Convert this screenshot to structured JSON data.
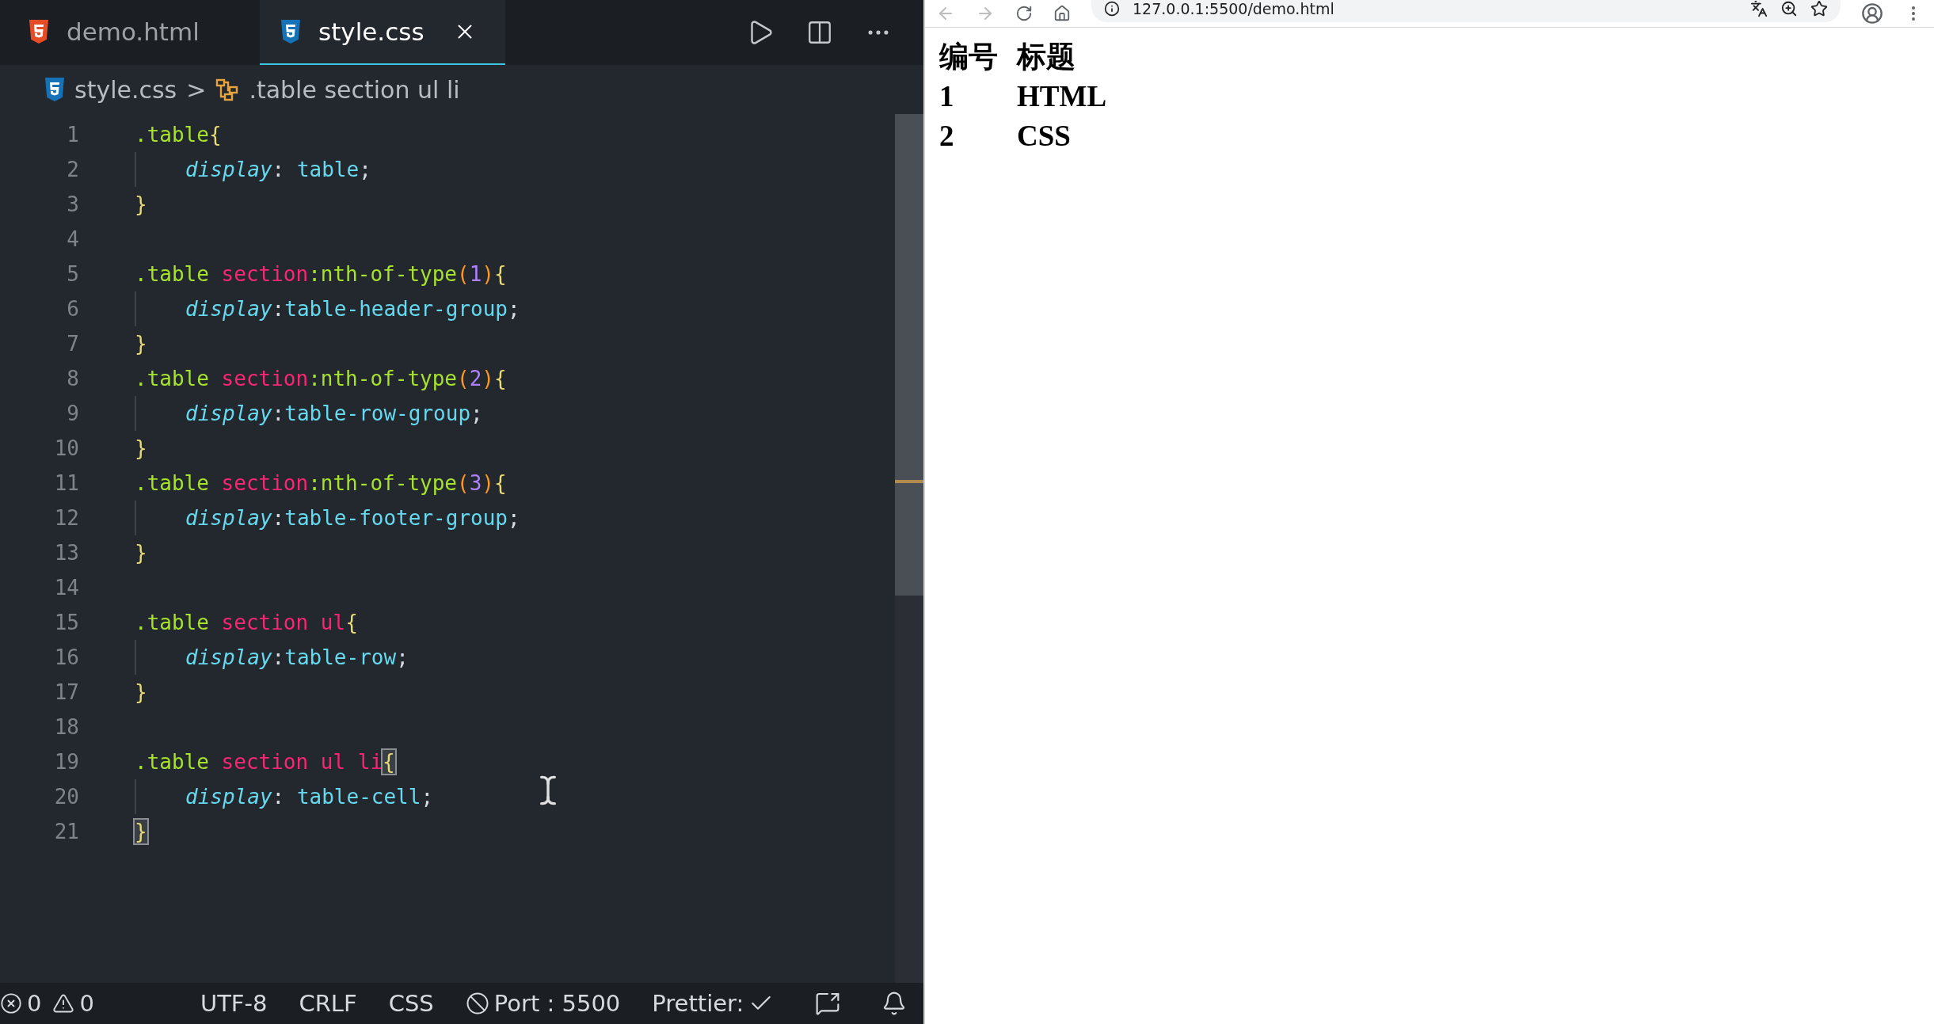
{
  "editor": {
    "tabs": [
      {
        "label": "demo.html",
        "kind": "html",
        "selected": false
      },
      {
        "label": "style.css",
        "kind": "css",
        "selected": true
      }
    ],
    "breadcrumb": {
      "file": "style.css",
      "separator": ">",
      "symbol": ".table section ul li"
    },
    "lines": [
      {
        "number": "1",
        "indented": false,
        "tokens": [
          {
            "text": ".table",
            "kind": "class"
          },
          {
            "text": "{",
            "kind": "brace"
          }
        ]
      },
      {
        "number": "2",
        "indented": true,
        "tokens": [
          {
            "text": "display",
            "kind": "prop"
          },
          {
            "text": ": ",
            "kind": "punct"
          },
          {
            "text": "table",
            "kind": "value"
          },
          {
            "text": ";",
            "kind": "punct"
          }
        ]
      },
      {
        "number": "3",
        "indented": false,
        "tokens": [
          {
            "text": "}",
            "kind": "brace"
          }
        ]
      },
      {
        "number": "4"
      },
      {
        "number": "5",
        "indented": false,
        "tokens": [
          {
            "text": ".table ",
            "kind": "class"
          },
          {
            "text": "section",
            "kind": "tag"
          },
          {
            "text": ":nth-of-type",
            "kind": "class"
          },
          {
            "text": "(",
            "kind": "paren"
          },
          {
            "text": "1",
            "kind": "number"
          },
          {
            "text": ")",
            "kind": "paren"
          },
          {
            "text": "{",
            "kind": "brace"
          }
        ]
      },
      {
        "number": "6",
        "indented": true,
        "tokens": [
          {
            "text": "display",
            "kind": "prop"
          },
          {
            "text": ":",
            "kind": "punct"
          },
          {
            "text": "table-header-group",
            "kind": "value"
          },
          {
            "text": ";",
            "kind": "punct"
          }
        ]
      },
      {
        "number": "7",
        "indented": false,
        "tokens": [
          {
            "text": "}",
            "kind": "brace"
          }
        ]
      },
      {
        "number": "8",
        "indented": false,
        "tokens": [
          {
            "text": ".table ",
            "kind": "class"
          },
          {
            "text": "section",
            "kind": "tag"
          },
          {
            "text": ":nth-of-type",
            "kind": "class"
          },
          {
            "text": "(",
            "kind": "paren"
          },
          {
            "text": "2",
            "kind": "number"
          },
          {
            "text": ")",
            "kind": "paren"
          },
          {
            "text": "{",
            "kind": "brace"
          }
        ]
      },
      {
        "number": "9",
        "indented": true,
        "tokens": [
          {
            "text": "display",
            "kind": "prop"
          },
          {
            "text": ":",
            "kind": "punct"
          },
          {
            "text": "table-row-group",
            "kind": "value"
          },
          {
            "text": ";",
            "kind": "punct"
          }
        ]
      },
      {
        "number": "10",
        "indented": false,
        "tokens": [
          {
            "text": "}",
            "kind": "brace"
          }
        ]
      },
      {
        "number": "11",
        "indented": false,
        "tokens": [
          {
            "text": ".table ",
            "kind": "class"
          },
          {
            "text": "section",
            "kind": "tag"
          },
          {
            "text": ":nth-of-type",
            "kind": "class"
          },
          {
            "text": "(",
            "kind": "paren"
          },
          {
            "text": "3",
            "kind": "number"
          },
          {
            "text": ")",
            "kind": "paren"
          },
          {
            "text": "{",
            "kind": "brace"
          }
        ]
      },
      {
        "number": "12",
        "indented": true,
        "tokens": [
          {
            "text": "display",
            "kind": "prop"
          },
          {
            "text": ":",
            "kind": "punct"
          },
          {
            "text": "table-footer-group",
            "kind": "value"
          },
          {
            "text": ";",
            "kind": "punct"
          }
        ]
      },
      {
        "number": "13",
        "indented": false,
        "tokens": [
          {
            "text": "}",
            "kind": "brace"
          }
        ]
      },
      {
        "number": "14"
      },
      {
        "number": "15",
        "indented": false,
        "tokens": [
          {
            "text": ".table ",
            "kind": "class"
          },
          {
            "text": "section ul",
            "kind": "tag"
          },
          {
            "text": "{",
            "kind": "brace"
          }
        ]
      },
      {
        "number": "16",
        "indented": true,
        "tokens": [
          {
            "text": "display",
            "kind": "prop"
          },
          {
            "text": ":",
            "kind": "punct"
          },
          {
            "text": "table-row",
            "kind": "value"
          },
          {
            "text": ";",
            "kind": "punct"
          }
        ]
      },
      {
        "number": "17",
        "indented": false,
        "tokens": [
          {
            "text": "}",
            "kind": "brace"
          }
        ]
      },
      {
        "number": "18"
      },
      {
        "number": "19",
        "indented": false,
        "tokens": [
          {
            "text": ".table ",
            "kind": "class"
          },
          {
            "text": "section ul li",
            "kind": "tag"
          },
          {
            "text": "{",
            "kind": "brace-match"
          }
        ]
      },
      {
        "number": "20",
        "indented": true,
        "tokens": [
          {
            "text": "display",
            "kind": "prop"
          },
          {
            "text": ": ",
            "kind": "punct"
          },
          {
            "text": "table-cell",
            "kind": "value"
          },
          {
            "text": ";",
            "kind": "punct"
          }
        ]
      },
      {
        "number": "21",
        "indented": false,
        "tokens": [
          {
            "text": "}",
            "kind": "brace-match"
          }
        ]
      }
    ]
  },
  "status_bar": {
    "errors": "0",
    "warnings": "0",
    "encoding": "UTF-8",
    "line_ending": "CRLF",
    "language": "CSS",
    "port": "Port : 5500",
    "formatter": "Prettier:"
  },
  "browser": {
    "address": "127.0.0.1:5500/demo.html",
    "rows": [
      {
        "cells": [
          "编号",
          "标题"
        ]
      },
      {
        "cells": [
          "1",
          "HTML"
        ]
      },
      {
        "cells": [
          "2",
          "CSS"
        ]
      }
    ]
  }
}
